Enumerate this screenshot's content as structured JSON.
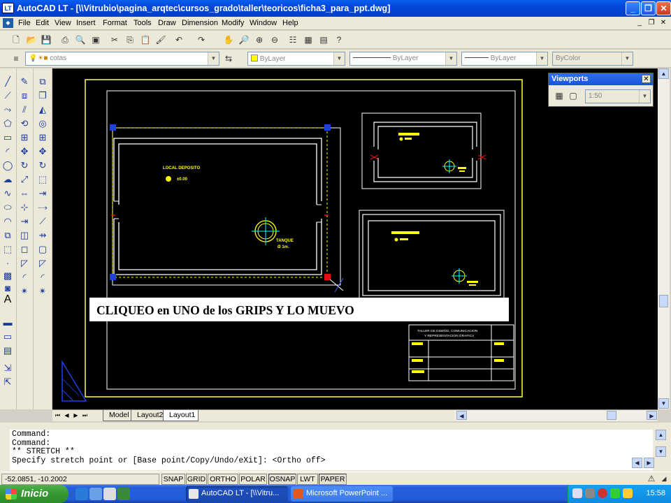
{
  "window": {
    "title": "AutoCAD LT - [\\\\Vitrubio\\pagina_arqtec\\cursos_grado\\taller\\teoricos\\ficha3_para_ppt.dwg]",
    "app_icon": "LT"
  },
  "menu": {
    "items": [
      "File",
      "Edit",
      "View",
      "Insert",
      "Format",
      "Tools",
      "Draw",
      "Dimension",
      "Modify",
      "Window",
      "Help"
    ]
  },
  "layer_toolbar": {
    "layer_name": "cotas",
    "color": "ByLayer",
    "linetype": "ByLayer",
    "lineweight": "ByLayer",
    "plotstyle": "ByColor"
  },
  "viewports_panel": {
    "title": "Viewports",
    "scale": "1:50"
  },
  "drawing": {
    "labels": {
      "local_deposito": "LOCAL DEPOSITO",
      "level": "±0.00",
      "tanque": "TANQUE",
      "diameter": "Ø 1m."
    },
    "title_block_line1": "TALLER DE DISEÑO, COMUNICACION",
    "title_block_line2": "Y REPRESENTACION GRAFICA",
    "colors": {
      "background": "#000000",
      "yellow": "#ffff00",
      "white": "#ffffff",
      "cyan": "#00ffff",
      "grip_blue": "#1f3fe0",
      "grip_red": "#e01010",
      "frame": "#ffff40"
    }
  },
  "caption": "CLIQUEO en UNO de los GRIPS Y LO MUEVO",
  "layout_tabs": {
    "tabs": [
      "Model",
      "Layout2",
      "Layout1"
    ],
    "active": "Layout1"
  },
  "command": {
    "lines": [
      "Command:",
      "Command:",
      "** STRETCH **",
      "Specify stretch point or [Base point/Copy/Undo/eXit]:  <Ortho off>"
    ]
  },
  "status": {
    "coords": "-52.0851, -10.2002",
    "toggles": [
      "SNAP",
      "GRID",
      "ORTHO",
      "POLAR",
      "OSNAP",
      "LWT",
      "PAPER"
    ],
    "active_toggles": [
      "OSNAP",
      "PAPER"
    ]
  },
  "taskbar": {
    "start_label": "Inicio",
    "tasks": [
      "AutoCAD LT - [\\\\Vitru...",
      "Microsoft PowerPoint ..."
    ],
    "clock": "15:58"
  }
}
